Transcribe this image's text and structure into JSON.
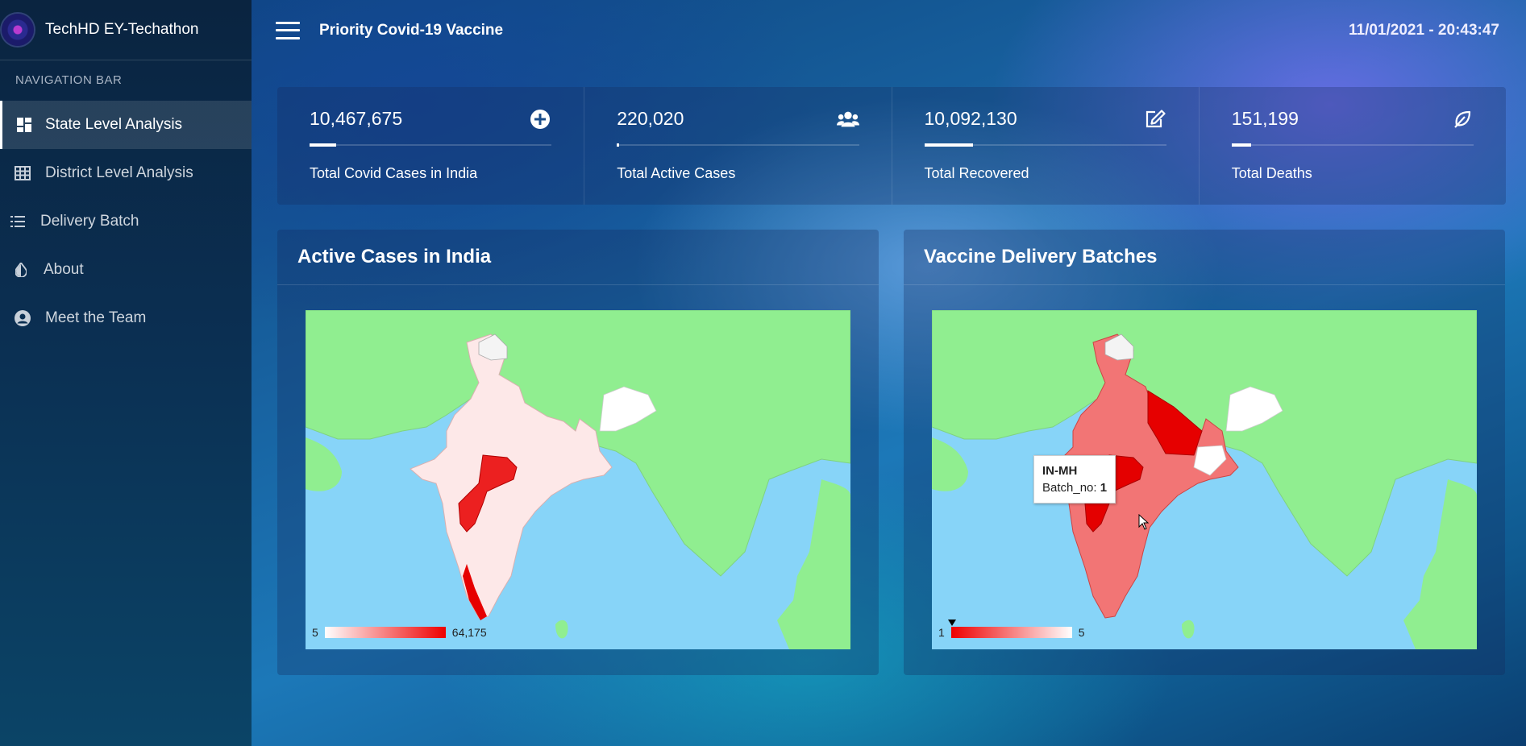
{
  "brand": {
    "name": "TechHD EY-Techathon"
  },
  "sidebar": {
    "heading": "NAVIGATION BAR",
    "items": [
      {
        "label": "State Level Analysis",
        "icon": "dashboard-icon",
        "active": true
      },
      {
        "label": "District Level Analysis",
        "icon": "grid-table-icon",
        "active": false
      },
      {
        "label": "Delivery Batch",
        "icon": "list-icon",
        "active": false
      },
      {
        "label": "About",
        "icon": "contrast-drop-icon",
        "active": false
      },
      {
        "label": "Meet the Team",
        "icon": "user-circle-icon",
        "active": false
      }
    ]
  },
  "header": {
    "title": "Priority Covid-19 Vaccine",
    "datetime": "11/01/2021 - 20:43:47"
  },
  "stats": [
    {
      "value": "10,467,675",
      "label": "Total Covid Cases in India",
      "icon": "plus-circle-icon",
      "progress": 0.11
    },
    {
      "value": "220,020",
      "label": "Total Active Cases",
      "icon": "users-icon",
      "progress": 0.01
    },
    {
      "value": "10,092,130",
      "label": "Total Recovered",
      "icon": "edit-icon",
      "progress": 0.2
    },
    {
      "value": "151,199",
      "label": "Total Deaths",
      "icon": "leaf-icon",
      "progress": 0.08
    }
  ],
  "cards": {
    "active_cases": {
      "title": "Active Cases in India",
      "legend_min": "5",
      "legend_max": "64,175",
      "colors": {
        "low": "#ffffff",
        "high": "#ee0000",
        "land": "#90ee90",
        "water": "#87d4f8"
      }
    },
    "delivery": {
      "title": "Vaccine Delivery Batches",
      "legend_min": "1",
      "legend_max": "5",
      "tooltip": {
        "title": "IN-MH",
        "label": "Batch_no:",
        "value": "1"
      }
    }
  }
}
